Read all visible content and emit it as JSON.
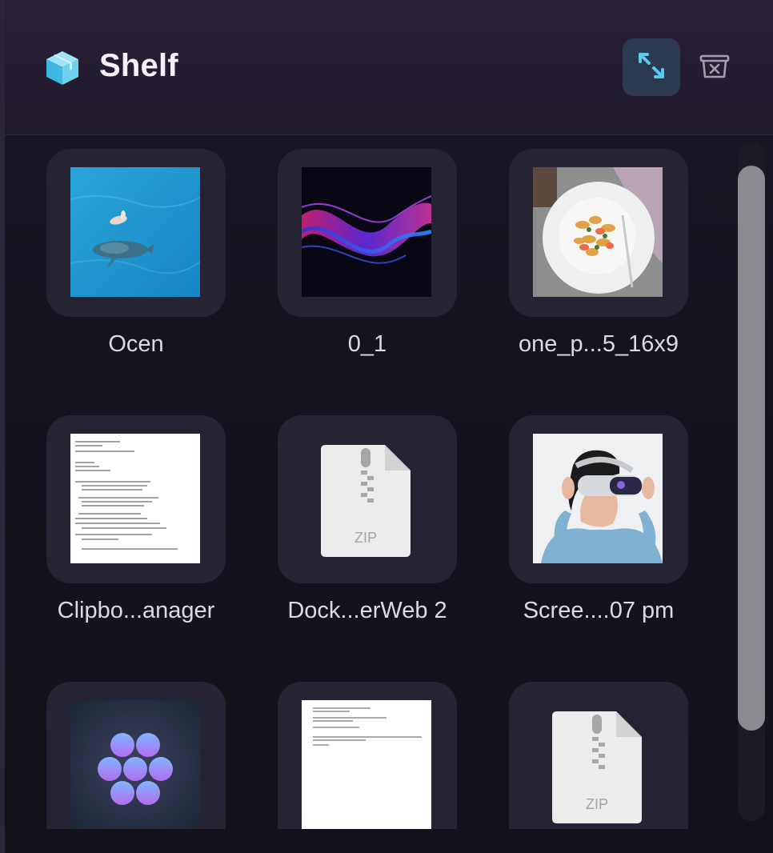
{
  "app": {
    "title": "Shelf",
    "icon": "package-box-icon"
  },
  "header": {
    "expand_icon": "expand-arrows-icon",
    "clear_icon": "clear-shelf-tray-icon",
    "accent": "#5ac8f0"
  },
  "items": [
    {
      "label": "Ocen",
      "kind": "image",
      "icon": "ocean-whale-thumbnail"
    },
    {
      "label": "0_1",
      "kind": "image",
      "icon": "abstract-wave-thumbnail"
    },
    {
      "label": "one_p...5_16x9",
      "kind": "image",
      "icon": "pasta-plate-thumbnail"
    },
    {
      "label": "Clipbo...anager",
      "kind": "document",
      "icon": "text-document-thumbnail"
    },
    {
      "label": "Dock...erWeb 2",
      "kind": "zip",
      "icon": "zip-archive-icon",
      "badge": "ZIP"
    },
    {
      "label": "Scree....07 pm",
      "kind": "image",
      "icon": "vr-headset-person-thumbnail"
    },
    {
      "label": "",
      "kind": "image",
      "icon": "purple-dots-app-thumbnail"
    },
    {
      "label": "",
      "kind": "document",
      "icon": "text-document-thumbnail"
    },
    {
      "label": "",
      "kind": "zip",
      "icon": "zip-archive-icon",
      "badge": "ZIP"
    }
  ]
}
